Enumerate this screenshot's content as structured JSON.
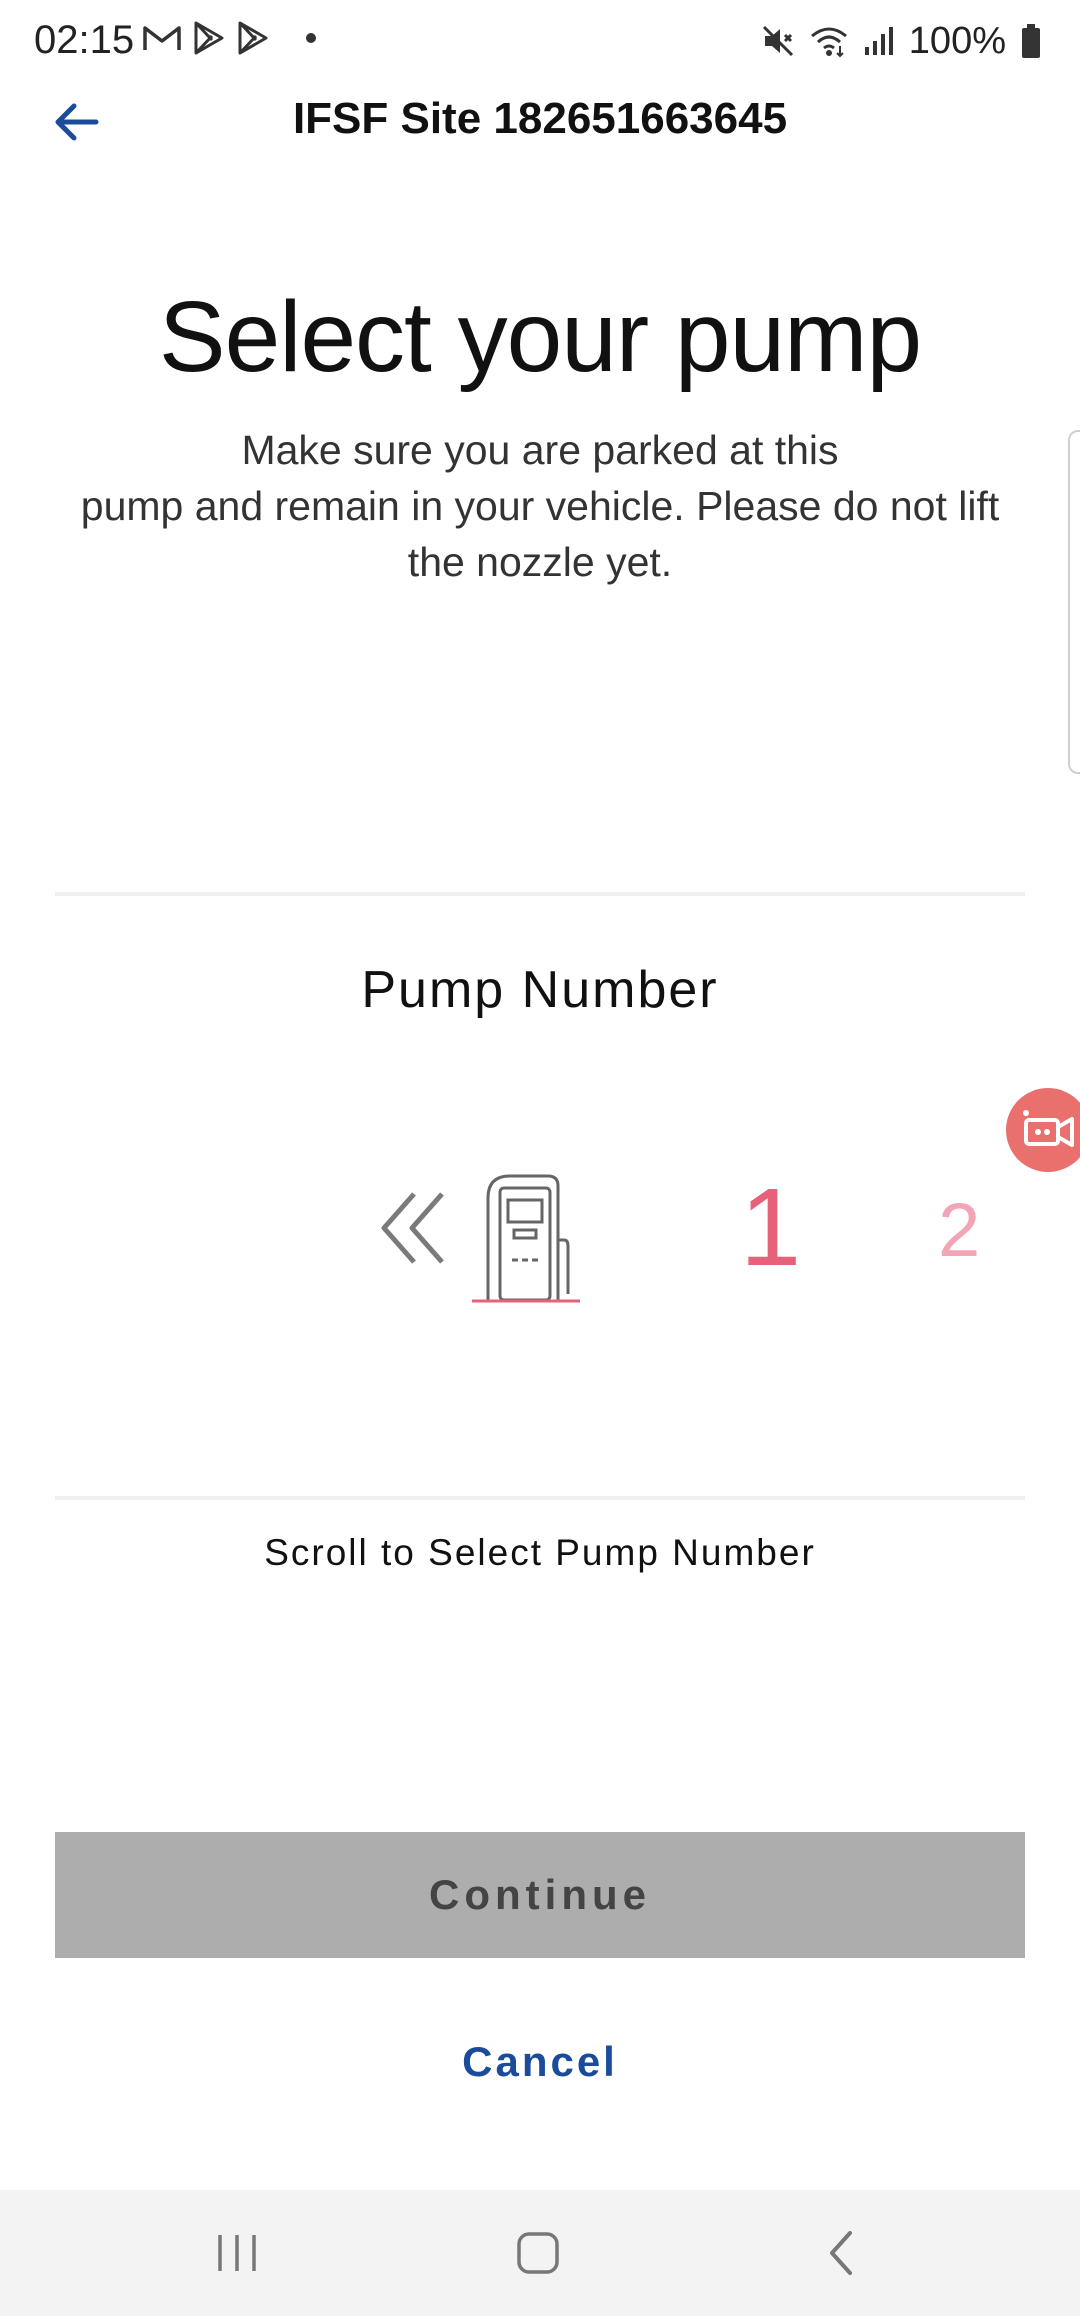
{
  "status_bar": {
    "time": "02:15",
    "battery_percent": "100%",
    "icons": [
      "gmail-icon",
      "play-store-icon",
      "play-store-icon",
      "notification-dot",
      "mute-icon",
      "wifi-icon",
      "signal-icon",
      "battery-icon"
    ]
  },
  "app_bar": {
    "back_icon": "arrow-left-icon",
    "title": "IFSF Site 182651663645"
  },
  "main": {
    "headline": "Select your pump",
    "subtitle_lines": [
      "Make sure you are parked at this",
      "pump and remain in your vehicle. Please do not lift",
      "the nozzle yet."
    ],
    "pump_number_label": "Pump Number",
    "picker": {
      "current": "1",
      "next": "2"
    },
    "scroll_hint": "Scroll to Select Pump Number"
  },
  "actions": {
    "continue_label": "Continue",
    "cancel_label": "Cancel"
  },
  "colors": {
    "accent_blue": "#1a4c9b",
    "selected_pink": "#e6617a",
    "next_pink": "#f2a5b5",
    "disabled_button": "#adadad",
    "fab_red": "#e9706c"
  }
}
